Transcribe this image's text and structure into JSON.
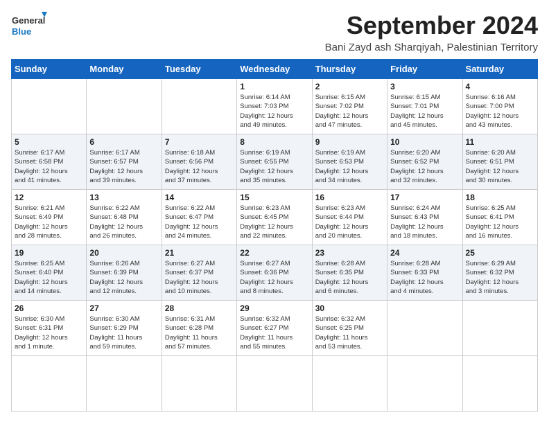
{
  "logo": {
    "line1": "General",
    "line2": "Blue"
  },
  "title": "September 2024",
  "location": "Bani Zayd ash Sharqiyah, Palestinian Territory",
  "weekdays": [
    "Sunday",
    "Monday",
    "Tuesday",
    "Wednesday",
    "Thursday",
    "Friday",
    "Saturday"
  ],
  "days": [
    {
      "date": "",
      "info": ""
    },
    {
      "date": "",
      "info": ""
    },
    {
      "date": "",
      "info": ""
    },
    {
      "date": "1",
      "info": "Sunrise: 6:14 AM\nSunset: 7:03 PM\nDaylight: 12 hours\nand 49 minutes."
    },
    {
      "date": "2",
      "info": "Sunrise: 6:15 AM\nSunset: 7:02 PM\nDaylight: 12 hours\nand 47 minutes."
    },
    {
      "date": "3",
      "info": "Sunrise: 6:15 AM\nSunset: 7:01 PM\nDaylight: 12 hours\nand 45 minutes."
    },
    {
      "date": "4",
      "info": "Sunrise: 6:16 AM\nSunset: 7:00 PM\nDaylight: 12 hours\nand 43 minutes."
    },
    {
      "date": "5",
      "info": "Sunrise: 6:17 AM\nSunset: 6:58 PM\nDaylight: 12 hours\nand 41 minutes."
    },
    {
      "date": "6",
      "info": "Sunrise: 6:17 AM\nSunset: 6:57 PM\nDaylight: 12 hours\nand 39 minutes."
    },
    {
      "date": "7",
      "info": "Sunrise: 6:18 AM\nSunset: 6:56 PM\nDaylight: 12 hours\nand 37 minutes."
    },
    {
      "date": "8",
      "info": "Sunrise: 6:19 AM\nSunset: 6:55 PM\nDaylight: 12 hours\nand 35 minutes."
    },
    {
      "date": "9",
      "info": "Sunrise: 6:19 AM\nSunset: 6:53 PM\nDaylight: 12 hours\nand 34 minutes."
    },
    {
      "date": "10",
      "info": "Sunrise: 6:20 AM\nSunset: 6:52 PM\nDaylight: 12 hours\nand 32 minutes."
    },
    {
      "date": "11",
      "info": "Sunrise: 6:20 AM\nSunset: 6:51 PM\nDaylight: 12 hours\nand 30 minutes."
    },
    {
      "date": "12",
      "info": "Sunrise: 6:21 AM\nSunset: 6:49 PM\nDaylight: 12 hours\nand 28 minutes."
    },
    {
      "date": "13",
      "info": "Sunrise: 6:22 AM\nSunset: 6:48 PM\nDaylight: 12 hours\nand 26 minutes."
    },
    {
      "date": "14",
      "info": "Sunrise: 6:22 AM\nSunset: 6:47 PM\nDaylight: 12 hours\nand 24 minutes."
    },
    {
      "date": "15",
      "info": "Sunrise: 6:23 AM\nSunset: 6:45 PM\nDaylight: 12 hours\nand 22 minutes."
    },
    {
      "date": "16",
      "info": "Sunrise: 6:23 AM\nSunset: 6:44 PM\nDaylight: 12 hours\nand 20 minutes."
    },
    {
      "date": "17",
      "info": "Sunrise: 6:24 AM\nSunset: 6:43 PM\nDaylight: 12 hours\nand 18 minutes."
    },
    {
      "date": "18",
      "info": "Sunrise: 6:25 AM\nSunset: 6:41 PM\nDaylight: 12 hours\nand 16 minutes."
    },
    {
      "date": "19",
      "info": "Sunrise: 6:25 AM\nSunset: 6:40 PM\nDaylight: 12 hours\nand 14 minutes."
    },
    {
      "date": "20",
      "info": "Sunrise: 6:26 AM\nSunset: 6:39 PM\nDaylight: 12 hours\nand 12 minutes."
    },
    {
      "date": "21",
      "info": "Sunrise: 6:27 AM\nSunset: 6:37 PM\nDaylight: 12 hours\nand 10 minutes."
    },
    {
      "date": "22",
      "info": "Sunrise: 6:27 AM\nSunset: 6:36 PM\nDaylight: 12 hours\nand 8 minutes."
    },
    {
      "date": "23",
      "info": "Sunrise: 6:28 AM\nSunset: 6:35 PM\nDaylight: 12 hours\nand 6 minutes."
    },
    {
      "date": "24",
      "info": "Sunrise: 6:28 AM\nSunset: 6:33 PM\nDaylight: 12 hours\nand 4 minutes."
    },
    {
      "date": "25",
      "info": "Sunrise: 6:29 AM\nSunset: 6:32 PM\nDaylight: 12 hours\nand 3 minutes."
    },
    {
      "date": "26",
      "info": "Sunrise: 6:30 AM\nSunset: 6:31 PM\nDaylight: 12 hours\nand 1 minute."
    },
    {
      "date": "27",
      "info": "Sunrise: 6:30 AM\nSunset: 6:29 PM\nDaylight: 11 hours\nand 59 minutes."
    },
    {
      "date": "28",
      "info": "Sunrise: 6:31 AM\nSunset: 6:28 PM\nDaylight: 11 hours\nand 57 minutes."
    },
    {
      "date": "29",
      "info": "Sunrise: 6:32 AM\nSunset: 6:27 PM\nDaylight: 11 hours\nand 55 minutes."
    },
    {
      "date": "30",
      "info": "Sunrise: 6:32 AM\nSunset: 6:25 PM\nDaylight: 11 hours\nand 53 minutes."
    },
    {
      "date": "",
      "info": ""
    },
    {
      "date": "",
      "info": ""
    },
    {
      "date": "",
      "info": ""
    },
    {
      "date": "",
      "info": ""
    },
    {
      "date": "",
      "info": ""
    }
  ]
}
